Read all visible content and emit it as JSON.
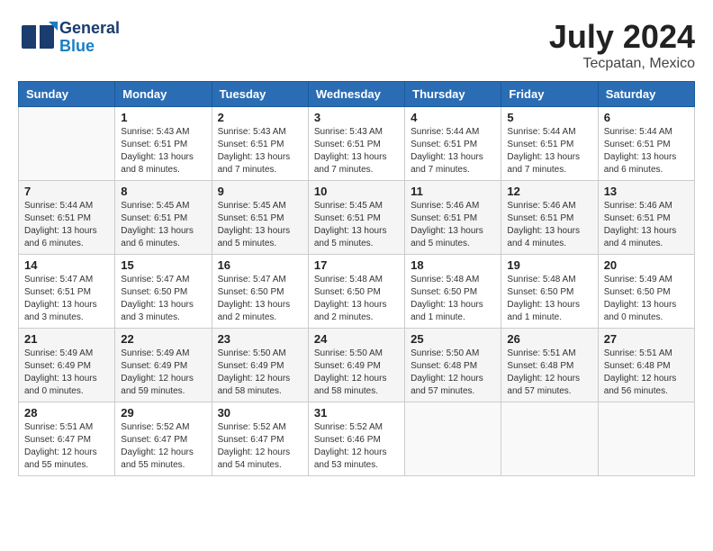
{
  "header": {
    "logo_line1": "General",
    "logo_line2": "Blue",
    "title": "July 2024",
    "location": "Tecpatan, Mexico"
  },
  "weekdays": [
    "Sunday",
    "Monday",
    "Tuesday",
    "Wednesday",
    "Thursday",
    "Friday",
    "Saturday"
  ],
  "weeks": [
    [
      {
        "day": "",
        "info": ""
      },
      {
        "day": "1",
        "info": "Sunrise: 5:43 AM\nSunset: 6:51 PM\nDaylight: 13 hours\nand 8 minutes."
      },
      {
        "day": "2",
        "info": "Sunrise: 5:43 AM\nSunset: 6:51 PM\nDaylight: 13 hours\nand 7 minutes."
      },
      {
        "day": "3",
        "info": "Sunrise: 5:43 AM\nSunset: 6:51 PM\nDaylight: 13 hours\nand 7 minutes."
      },
      {
        "day": "4",
        "info": "Sunrise: 5:44 AM\nSunset: 6:51 PM\nDaylight: 13 hours\nand 7 minutes."
      },
      {
        "day": "5",
        "info": "Sunrise: 5:44 AM\nSunset: 6:51 PM\nDaylight: 13 hours\nand 7 minutes."
      },
      {
        "day": "6",
        "info": "Sunrise: 5:44 AM\nSunset: 6:51 PM\nDaylight: 13 hours\nand 6 minutes."
      }
    ],
    [
      {
        "day": "7",
        "info": "Sunrise: 5:44 AM\nSunset: 6:51 PM\nDaylight: 13 hours\nand 6 minutes."
      },
      {
        "day": "8",
        "info": "Sunrise: 5:45 AM\nSunset: 6:51 PM\nDaylight: 13 hours\nand 6 minutes."
      },
      {
        "day": "9",
        "info": "Sunrise: 5:45 AM\nSunset: 6:51 PM\nDaylight: 13 hours\nand 5 minutes."
      },
      {
        "day": "10",
        "info": "Sunrise: 5:45 AM\nSunset: 6:51 PM\nDaylight: 13 hours\nand 5 minutes."
      },
      {
        "day": "11",
        "info": "Sunrise: 5:46 AM\nSunset: 6:51 PM\nDaylight: 13 hours\nand 5 minutes."
      },
      {
        "day": "12",
        "info": "Sunrise: 5:46 AM\nSunset: 6:51 PM\nDaylight: 13 hours\nand 4 minutes."
      },
      {
        "day": "13",
        "info": "Sunrise: 5:46 AM\nSunset: 6:51 PM\nDaylight: 13 hours\nand 4 minutes."
      }
    ],
    [
      {
        "day": "14",
        "info": "Sunrise: 5:47 AM\nSunset: 6:51 PM\nDaylight: 13 hours\nand 3 minutes."
      },
      {
        "day": "15",
        "info": "Sunrise: 5:47 AM\nSunset: 6:50 PM\nDaylight: 13 hours\nand 3 minutes."
      },
      {
        "day": "16",
        "info": "Sunrise: 5:47 AM\nSunset: 6:50 PM\nDaylight: 13 hours\nand 2 minutes."
      },
      {
        "day": "17",
        "info": "Sunrise: 5:48 AM\nSunset: 6:50 PM\nDaylight: 13 hours\nand 2 minutes."
      },
      {
        "day": "18",
        "info": "Sunrise: 5:48 AM\nSunset: 6:50 PM\nDaylight: 13 hours\nand 1 minute."
      },
      {
        "day": "19",
        "info": "Sunrise: 5:48 AM\nSunset: 6:50 PM\nDaylight: 13 hours\nand 1 minute."
      },
      {
        "day": "20",
        "info": "Sunrise: 5:49 AM\nSunset: 6:50 PM\nDaylight: 13 hours\nand 0 minutes."
      }
    ],
    [
      {
        "day": "21",
        "info": "Sunrise: 5:49 AM\nSunset: 6:49 PM\nDaylight: 13 hours\nand 0 minutes."
      },
      {
        "day": "22",
        "info": "Sunrise: 5:49 AM\nSunset: 6:49 PM\nDaylight: 12 hours\nand 59 minutes."
      },
      {
        "day": "23",
        "info": "Sunrise: 5:50 AM\nSunset: 6:49 PM\nDaylight: 12 hours\nand 58 minutes."
      },
      {
        "day": "24",
        "info": "Sunrise: 5:50 AM\nSunset: 6:49 PM\nDaylight: 12 hours\nand 58 minutes."
      },
      {
        "day": "25",
        "info": "Sunrise: 5:50 AM\nSunset: 6:48 PM\nDaylight: 12 hours\nand 57 minutes."
      },
      {
        "day": "26",
        "info": "Sunrise: 5:51 AM\nSunset: 6:48 PM\nDaylight: 12 hours\nand 57 minutes."
      },
      {
        "day": "27",
        "info": "Sunrise: 5:51 AM\nSunset: 6:48 PM\nDaylight: 12 hours\nand 56 minutes."
      }
    ],
    [
      {
        "day": "28",
        "info": "Sunrise: 5:51 AM\nSunset: 6:47 PM\nDaylight: 12 hours\nand 55 minutes."
      },
      {
        "day": "29",
        "info": "Sunrise: 5:52 AM\nSunset: 6:47 PM\nDaylight: 12 hours\nand 55 minutes."
      },
      {
        "day": "30",
        "info": "Sunrise: 5:52 AM\nSunset: 6:47 PM\nDaylight: 12 hours\nand 54 minutes."
      },
      {
        "day": "31",
        "info": "Sunrise: 5:52 AM\nSunset: 6:46 PM\nDaylight: 12 hours\nand 53 minutes."
      },
      {
        "day": "",
        "info": ""
      },
      {
        "day": "",
        "info": ""
      },
      {
        "day": "",
        "info": ""
      }
    ]
  ]
}
